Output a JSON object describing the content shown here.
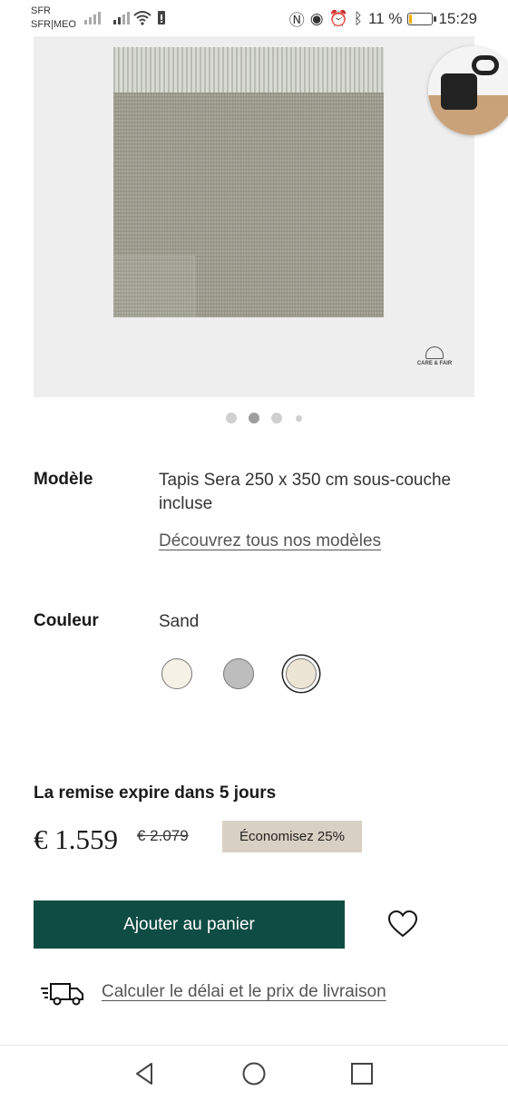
{
  "status_bar": {
    "carrier_1": "SFR",
    "carrier_2": "SFR|MEO",
    "battery_percent": "11 %",
    "battery_level": 0.11,
    "time": "15:29",
    "icons": [
      "signal-icon",
      "wifi-icon",
      "battery-alert-icon",
      "nfc-icon",
      "eye-icon",
      "alarm-icon",
      "bluetooth-icon"
    ]
  },
  "gallery": {
    "logo_text": "CARE & FAIR",
    "dots_count": 4,
    "active_dot": 2
  },
  "model": {
    "label": "Modèle",
    "value": "Tapis Sera 250 x 350 cm sous-couche incluse",
    "link": "Découvrez tous nos modèles"
  },
  "color": {
    "label": "Couleur",
    "value": "Sand",
    "swatches": [
      {
        "name": "ivory",
        "hex": "#f6f1e6"
      },
      {
        "name": "grey",
        "hex": "#bdbdbd"
      },
      {
        "name": "sand",
        "hex": "#ece4d4",
        "selected": true
      }
    ]
  },
  "pricing": {
    "discount_title": "La remise expire dans 5 jours",
    "price": "€ 1.559",
    "old_price": "€ 2.079",
    "savings": "Économisez 25%"
  },
  "actions": {
    "add_to_cart": "Ajouter au panier",
    "shipping_link": "Calculer le délai et le prix de livraison"
  },
  "colors": {
    "accent": "#0f4c43",
    "badge": "#d8d0c2"
  },
  "nav": {
    "icons": [
      "back-icon",
      "home-icon",
      "recents-icon"
    ]
  }
}
